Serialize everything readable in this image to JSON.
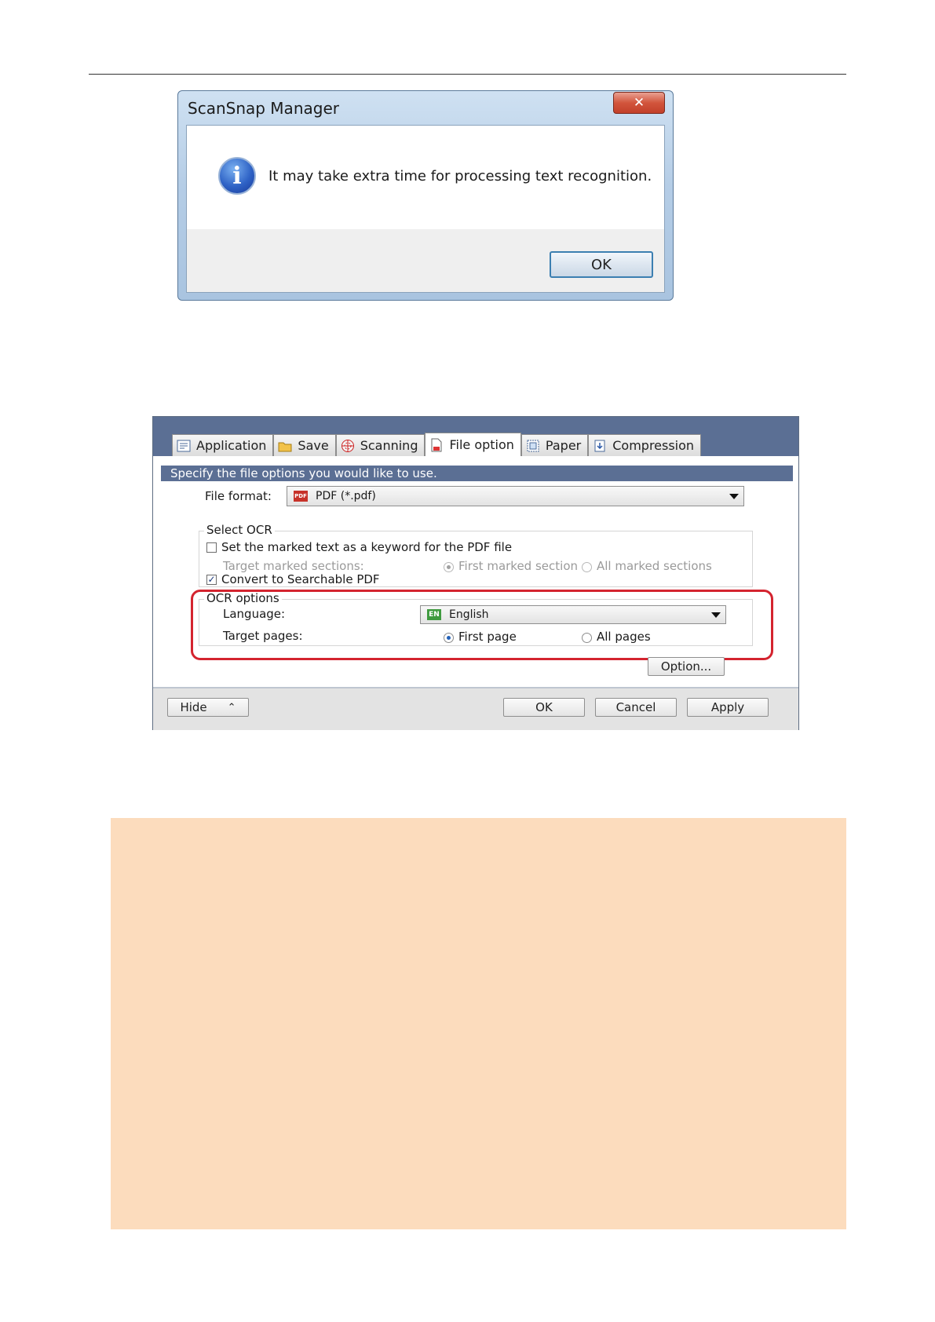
{
  "message_box": {
    "title": "ScanSnap Manager",
    "close_symbol": "✕",
    "icon": "info-icon",
    "icon_glyph": "i",
    "message": "It may take extra time for processing text recognition.",
    "ok_label": "OK"
  },
  "settings": {
    "tabs": [
      {
        "label": "Application",
        "icon": "application-icon"
      },
      {
        "label": "Save",
        "icon": "folder-icon"
      },
      {
        "label": "Scanning",
        "icon": "scanning-icon"
      },
      {
        "label": "File option",
        "icon": "file-icon"
      },
      {
        "label": "Paper",
        "icon": "paper-icon"
      },
      {
        "label": "Compression",
        "icon": "compression-icon"
      }
    ],
    "active_tab": "File option",
    "banner": "Specify the file options you would like to use.",
    "file_format_label": "File format:",
    "file_format_icon_text": "PDF",
    "file_format_value": "PDF (*.pdf)",
    "select_ocr": {
      "title": "Select OCR",
      "keyword_label": "Set the marked text as a keyword for the PDF file",
      "keyword_checked": false,
      "target_label": "Target marked sections:",
      "first_marked_label": "First marked section",
      "all_marked_label": "All marked sections",
      "convert_label": "Convert to Searchable PDF",
      "convert_checked": true,
      "check_glyph": "✓"
    },
    "ocr_options": {
      "title": "OCR options",
      "language_label": "Language:",
      "language_icon_text": "EN",
      "language_value": "English",
      "target_pages_label": "Target pages:",
      "first_page_label": "First page",
      "all_pages_label": "All pages",
      "selected_target": "First page"
    },
    "option_button": "Option...",
    "footer": {
      "hide_label": "Hide",
      "hide_glyph": "⌃",
      "ok_label": "OK",
      "cancel_label": "Cancel",
      "apply_label": "Apply"
    },
    "highlight_color": "#d4242f"
  },
  "note_box": {
    "background_color": "#fcdcbd"
  }
}
